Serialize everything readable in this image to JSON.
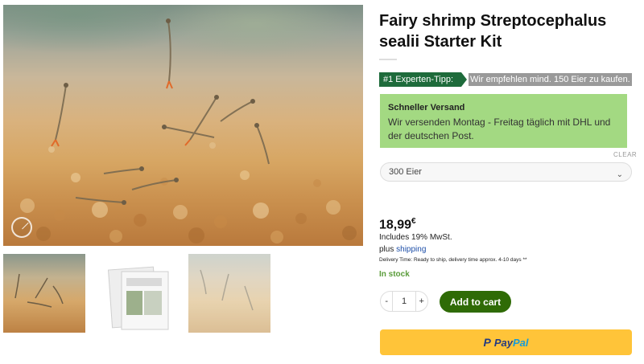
{
  "product": {
    "title": "Fairy shrimp Streptocephalus sealii Starter Kit",
    "price": "18,99",
    "currency": "€",
    "tax_note": "Includes 19% MwSt.",
    "shipping_prefix": "plus",
    "shipping_link": "shipping",
    "delivery_time": "Delivery Time: Ready to ship, delivery time approx. 4-10 days **",
    "stock_status": "In stock"
  },
  "tip": {
    "badge": "#1 Experten-Tipp:",
    "text": "Wir empfehlen mind. 150 Eier zu kaufen."
  },
  "shipping_box": {
    "title": "Schneller Versand",
    "text": "Wir versenden Montag - Freitag täglich mit DHL und der deutschen Post."
  },
  "variant": {
    "clear_label": "CLEAR",
    "selected": "300 Eier"
  },
  "cart": {
    "minus": "-",
    "quantity": "1",
    "plus": "+",
    "add_label": "Add to cart"
  },
  "paypal": {
    "part1": "Pay",
    "part2": "Pal"
  },
  "colors": {
    "expert_badge": "#1e6b3b",
    "shipping_box_bg": "#a3d982",
    "add_to_cart_bg": "#2f6b06",
    "paypal_bg": "#ffc439",
    "stock": "#5a9c3a"
  },
  "icons": {
    "zoom": "expand-icon",
    "select": "chevron-down-icon",
    "paypal": "paypal-logo-icon"
  }
}
